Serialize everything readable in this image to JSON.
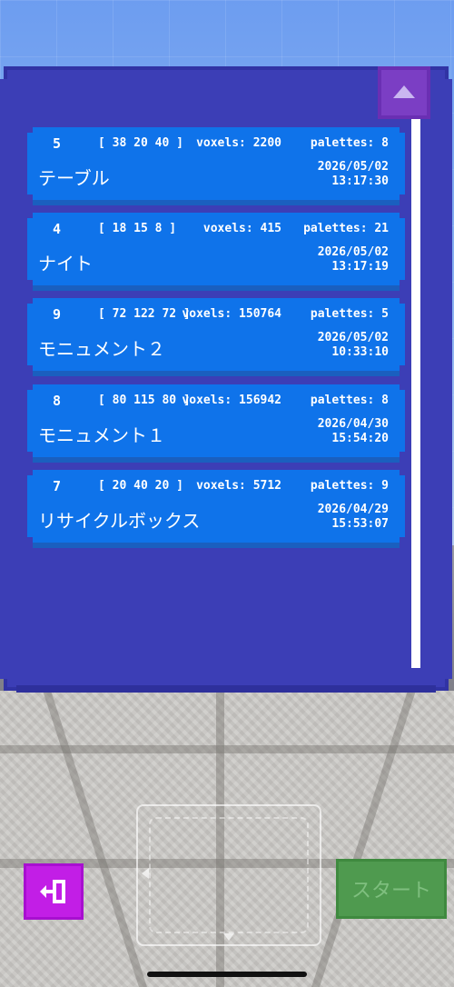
{
  "colors": {
    "panel": "#3c3eb6",
    "card": "#0f73ea",
    "scroll_button": "#7b3ec4",
    "exit_button": "#c21ee6",
    "start_button": "#4f9a4f"
  },
  "scroll": {
    "up_icon": "triangle-up-icon"
  },
  "models": [
    {
      "id": "5",
      "dims": "[ 38 20 40 ]",
      "voxels": "voxels: 2200",
      "palettes": "palettes: 8",
      "name": "テーブル",
      "date": "2026/05/02",
      "time": "13:17:30"
    },
    {
      "id": "4",
      "dims": "[ 18 15 8 ]",
      "voxels": "voxels: 415",
      "palettes": "palettes: 21",
      "name": "ナイト",
      "date": "2026/05/02",
      "time": "13:17:19"
    },
    {
      "id": "9",
      "dims": "[ 72 122 72 ]",
      "voxels": "voxels: 150764",
      "palettes": "palettes: 5",
      "name": "モニュメント２",
      "date": "2026/05/02",
      "time": "10:33:10"
    },
    {
      "id": "8",
      "dims": "[ 80 115 80 ]",
      "voxels": "voxels: 156942",
      "palettes": "palettes: 8",
      "name": "モニュメント１",
      "date": "2026/04/30",
      "time": "15:54:20"
    },
    {
      "id": "7",
      "dims": "[ 20 40 20 ]",
      "voxels": "voxels: 5712",
      "palettes": "palettes: 9",
      "name": "リサイクルボックス",
      "date": "2026/04/29",
      "time": "15:53:07"
    }
  ],
  "hud": {
    "exit_icon": "exit-door-icon",
    "start_label": "スタート"
  }
}
